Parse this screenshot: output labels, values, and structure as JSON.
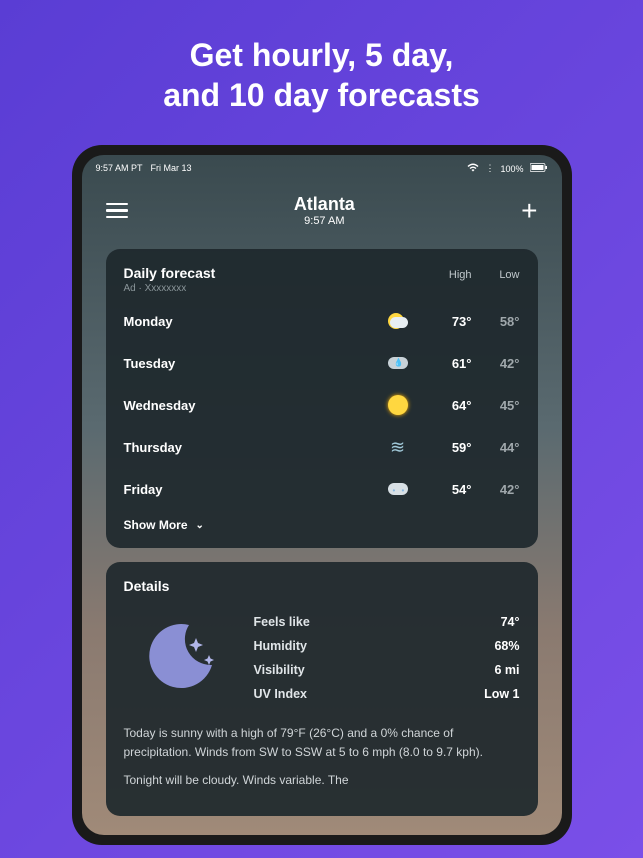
{
  "promo": {
    "line1": "Get hourly, 5 day,",
    "line2": "and 10 day forecasts"
  },
  "status_bar": {
    "time": "9:57 AM PT",
    "date": "Fri Mar 13",
    "battery": "100%"
  },
  "header": {
    "location": "Atlanta",
    "time": "9:57 AM"
  },
  "forecast": {
    "title": "Daily forecast",
    "ad_label": "Ad · Xxxxxxxx",
    "high_label": "High",
    "low_label": "Low",
    "days": [
      {
        "name": "Monday",
        "icon": "partly-cloudy",
        "high": "73°",
        "low": "58°"
      },
      {
        "name": "Tuesday",
        "icon": "rainy",
        "high": "61°",
        "low": "42°"
      },
      {
        "name": "Wednesday",
        "icon": "sunny",
        "high": "64°",
        "low": "45°"
      },
      {
        "name": "Thursday",
        "icon": "wind",
        "high": "59°",
        "low": "44°"
      },
      {
        "name": "Friday",
        "icon": "snowy",
        "high": "54°",
        "low": "42°"
      }
    ],
    "show_more": "Show More"
  },
  "details": {
    "title": "Details",
    "rows": [
      {
        "label": "Feels like",
        "value": "74°"
      },
      {
        "label": "Humidity",
        "value": "68%"
      },
      {
        "label": "Visibility",
        "value": "6 mi"
      },
      {
        "label": "UV Index",
        "value": "Low 1"
      }
    ],
    "text1": "Today is sunny with a high of 79°F (26°C) and a 0% chance of precipitation. Winds from SW to SSW at 5 to 6 mph (8.0 to 9.7 kph).",
    "text2": "Tonight will be cloudy. Winds variable. The"
  }
}
